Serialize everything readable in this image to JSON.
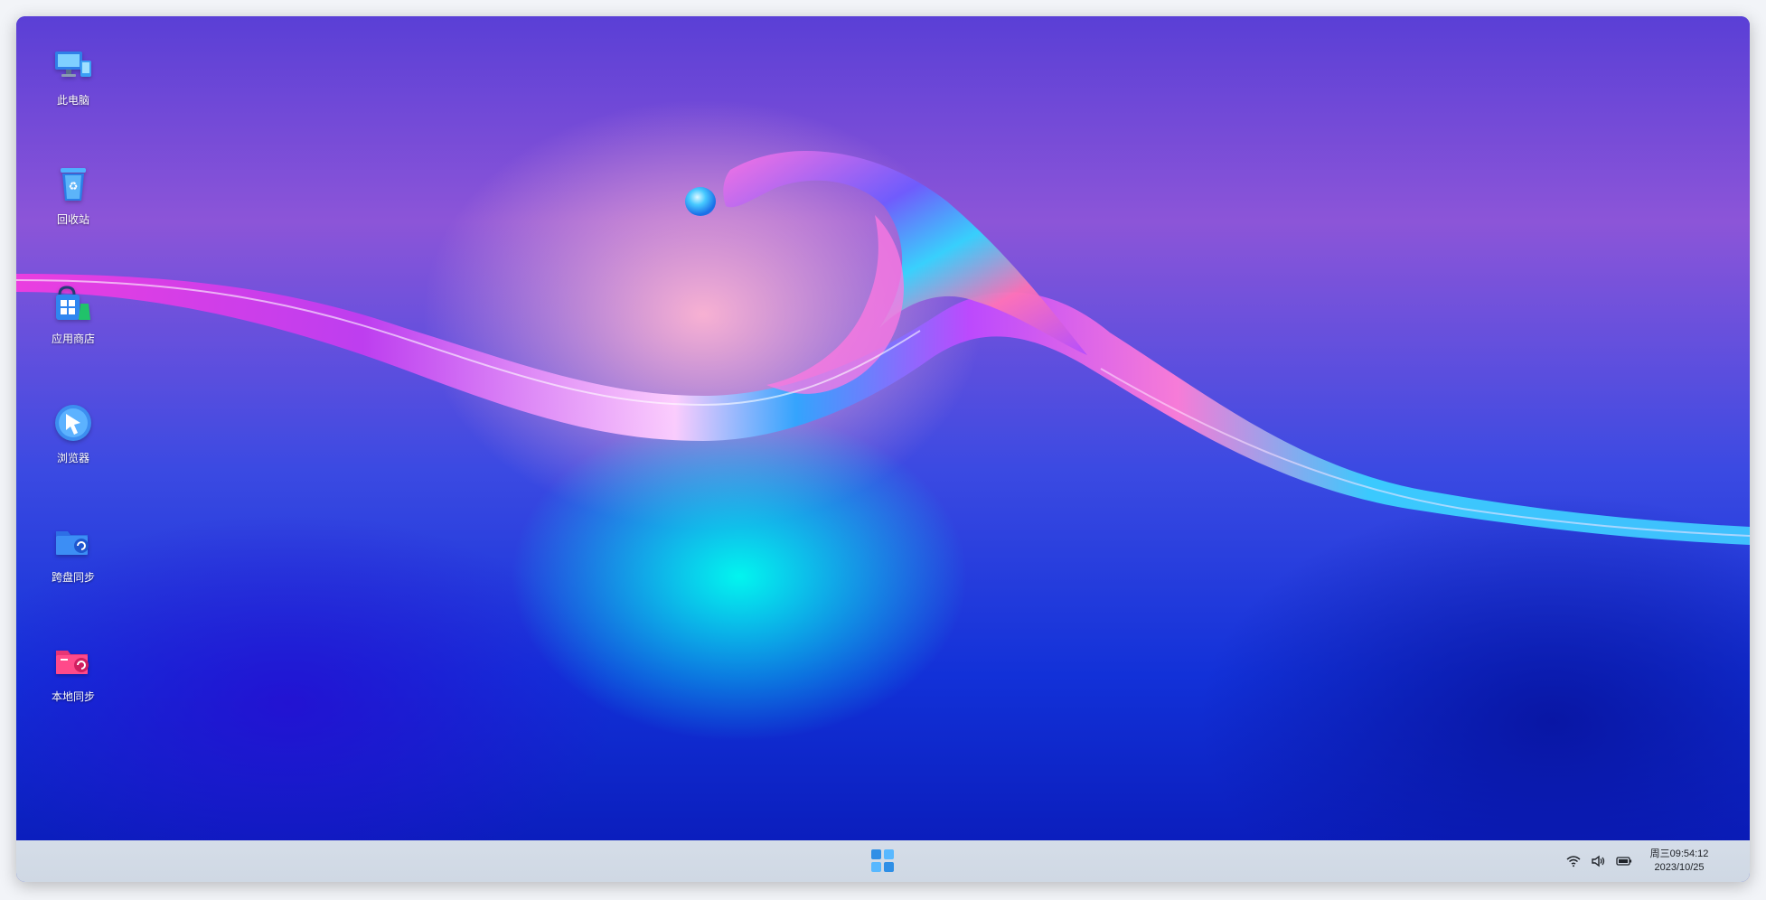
{
  "desktop": {
    "icons": [
      {
        "label": "此电脑",
        "icon": "computer-icon"
      },
      {
        "label": "回收站",
        "icon": "recycle-bin-icon"
      },
      {
        "label": "应用商店",
        "icon": "app-store-icon"
      },
      {
        "label": "浏览器",
        "icon": "browser-icon"
      },
      {
        "label": "跨盘同步",
        "icon": "cross-disk-sync-icon"
      },
      {
        "label": "本地同步",
        "icon": "local-sync-icon"
      }
    ]
  },
  "taskbar": {
    "start_icon": "start-menu-icon",
    "tray_icons": [
      "wifi-icon",
      "volume-icon",
      "battery-icon"
    ],
    "clock": {
      "line1": "周三09:54:12",
      "line2": "2023/10/25"
    }
  },
  "colors": {
    "start_tile_blue": "#2f8fe6",
    "start_tile_light": "#58b8ff",
    "taskbar_bg": "#d2dbe6"
  }
}
